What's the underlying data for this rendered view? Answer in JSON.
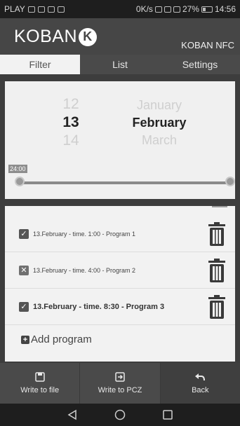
{
  "status": {
    "left_text": "PLAY",
    "right_text": "0K/s",
    "battery": "27%",
    "time": "14:56",
    "battery_fill": 0.27
  },
  "app": {
    "logo_text": "KOBAN",
    "logo_mark": "K",
    "title": "KOBAN NFC"
  },
  "tabs": [
    {
      "label": "Filter",
      "active": true
    },
    {
      "label": "List",
      "active": false
    },
    {
      "label": "Settings",
      "active": false
    }
  ],
  "picker": {
    "days": [
      "12",
      "13",
      "14"
    ],
    "months": [
      "January",
      "February",
      "March"
    ],
    "selected_day": "13",
    "selected_month": "February"
  },
  "slider": {
    "label": "24:00",
    "start": 0,
    "end": 1
  },
  "programs": [
    {
      "text": "13.February - time. 1:00 - Program 1",
      "state": "checked",
      "bold": false
    },
    {
      "text": "13.February - time. 4:00 - Program 2",
      "state": "crossed",
      "bold": false
    },
    {
      "text": "13.February - time. 8:30 - Program 3",
      "state": "checked",
      "bold": true
    }
  ],
  "add_program_label": "Add program",
  "bottom_actions": [
    {
      "label": "Write to file",
      "icon": "save-icon"
    },
    {
      "label": "Write to PCZ",
      "icon": "export-icon"
    },
    {
      "label": "Back",
      "icon": "back-arrow-icon"
    }
  ],
  "icons": {
    "trash": "trash-icon",
    "nav_back": "nav-back-icon",
    "nav_home": "nav-home-icon",
    "nav_recents": "nav-recents-icon"
  }
}
